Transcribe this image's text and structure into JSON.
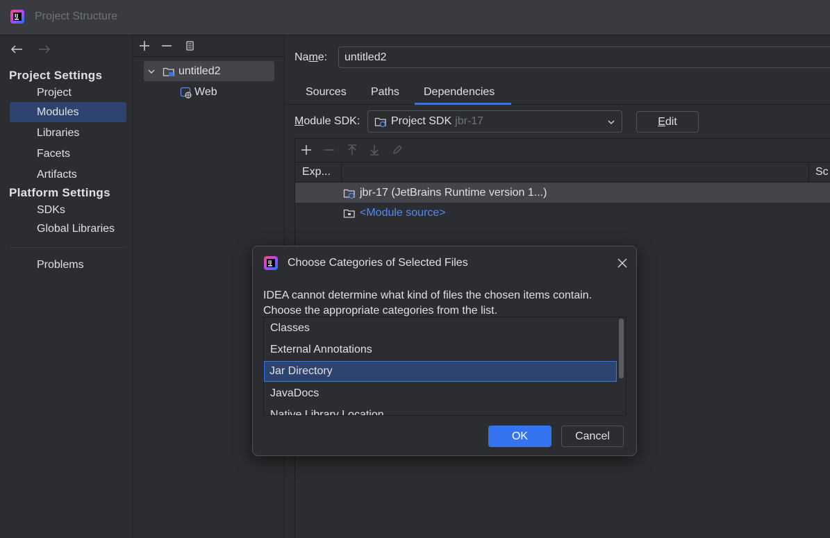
{
  "window": {
    "title": "Project Structure",
    "logo_icon": "intellij-idea-logo-icon"
  },
  "nav": {
    "back_icon": "arrow-left-icon",
    "forward_icon": "arrow-right-icon",
    "project_settings_header": "Project Settings",
    "project_settings_items": [
      {
        "label": "Project",
        "selected": false
      },
      {
        "label": "Modules",
        "selected": true
      },
      {
        "label": "Libraries",
        "selected": false
      },
      {
        "label": "Facets",
        "selected": false
      },
      {
        "label": "Artifacts",
        "selected": false
      }
    ],
    "platform_settings_header": "Platform Settings",
    "platform_settings_items": [
      {
        "label": "SDKs"
      },
      {
        "label": "Global Libraries"
      }
    ],
    "problems_label": "Problems"
  },
  "tree": {
    "toolbar": [
      "plus-icon",
      "minus-icon",
      "copy-icon"
    ],
    "root": {
      "label": "untitled2",
      "expanded": true,
      "selected": true
    },
    "children": [
      {
        "label": "Web"
      }
    ]
  },
  "module": {
    "name_label_pre": "Na",
    "name_label_mnemonic": "m",
    "name_label_post": "e:",
    "name_value": "untitled2",
    "tabs": [
      {
        "label": "Sources",
        "active": false
      },
      {
        "label": "Paths",
        "active": false
      },
      {
        "label": "Dependencies",
        "active": true
      }
    ],
    "sdk_label_mnemonic": "M",
    "sdk_label_rest": "odule SDK:",
    "sdk_value": "Project SDK",
    "sdk_value_muted": "jbr-17",
    "edit_mnemonic": "E",
    "edit_rest": "dit",
    "deps_toolbar": [
      "plus-icon",
      "minus-icon",
      "move-up-icon",
      "move-down-icon",
      "pencil-icon"
    ],
    "deps_columns": [
      "Exp...",
      "",
      "Sc"
    ],
    "deps_rows": [
      {
        "label": "jbr-17 (JetBrains Runtime version 1...)",
        "selected": true,
        "link": false
      },
      {
        "label": "<Module source>",
        "selected": false,
        "link": true
      }
    ]
  },
  "dialog": {
    "title": "Choose Categories of Selected Files",
    "close_icon": "close-icon",
    "message_line1": "IDEA cannot determine what kind of files the chosen items contain.",
    "message_line2": "Choose the appropriate categories from the list.",
    "categories": [
      {
        "label": "Classes",
        "selected": false
      },
      {
        "label": "External Annotations",
        "selected": false
      },
      {
        "label": "Jar Directory",
        "selected": true
      },
      {
        "label": "JavaDocs",
        "selected": false
      },
      {
        "label": "Native Library Location",
        "selected": false
      }
    ],
    "ok_label": "OK",
    "cancel_label": "Cancel"
  },
  "colors": {
    "background": "#2b2d30",
    "titlebar": "#393b40",
    "selection_blue": "#2e436e",
    "accent": "#3574f0",
    "link": "#548af7"
  }
}
